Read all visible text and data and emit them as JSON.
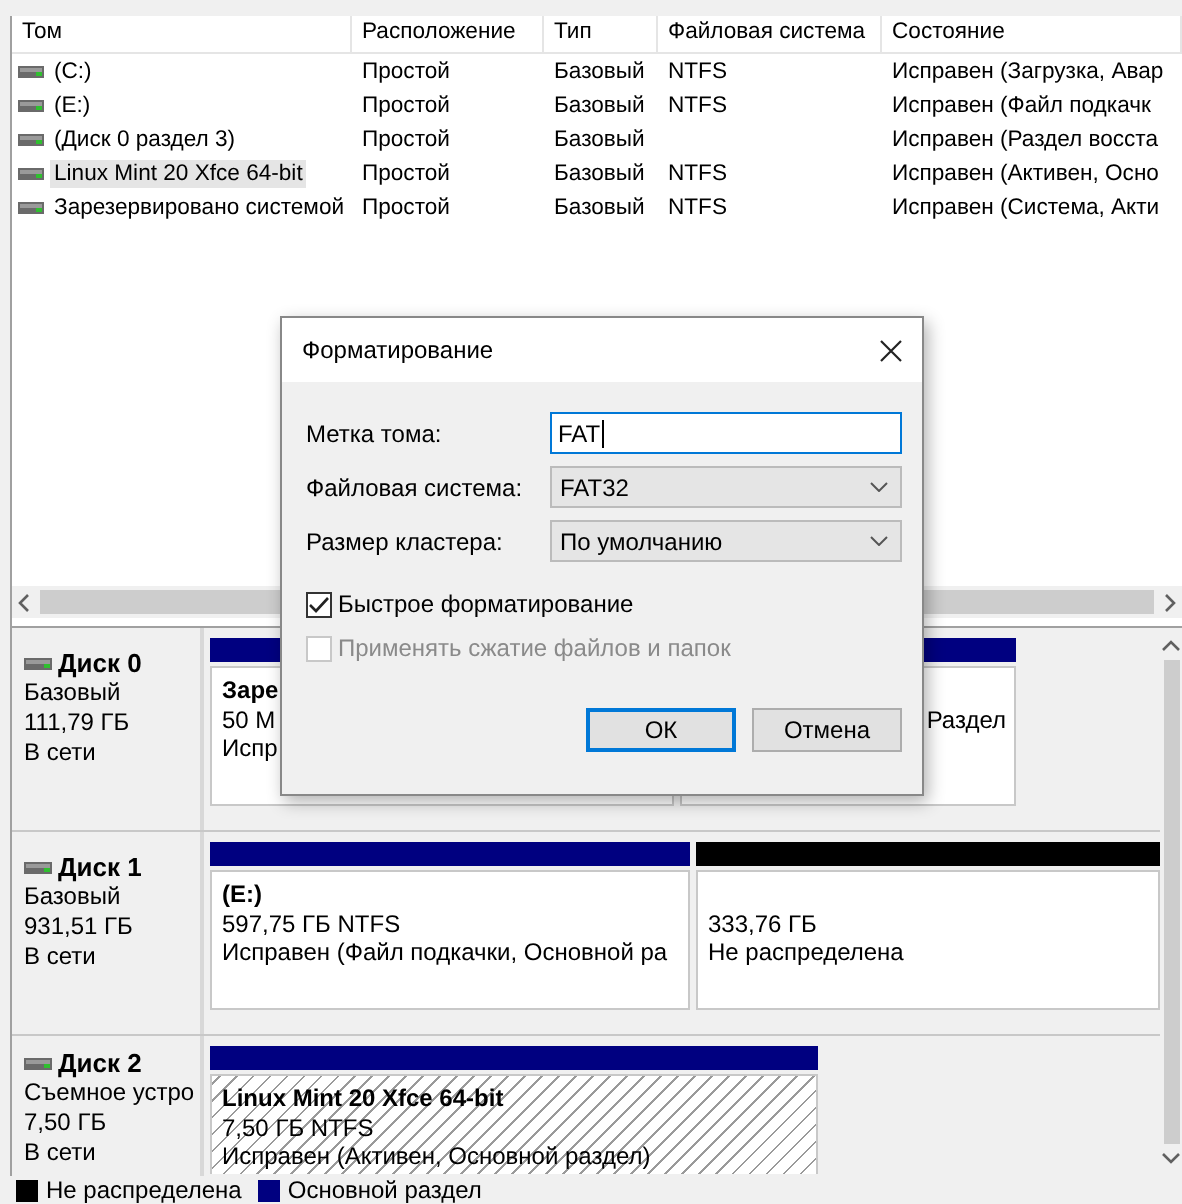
{
  "volume_table": {
    "columns": [
      "Том",
      "Расположение",
      "Тип",
      "Файловая система",
      "Состояние"
    ],
    "rows": [
      {
        "cells": [
          " (C:)",
          "Простой",
          "Базовый",
          "NTFS",
          "Исправен (Загрузка, Авар"
        ],
        "selected": false
      },
      {
        "cells": [
          " (E:)",
          "Простой",
          "Базовый",
          "NTFS",
          "Исправен (Файл подкачк"
        ],
        "selected": false
      },
      {
        "cells": [
          "(Диск 0 раздел 3)",
          "Простой",
          "Базовый",
          "",
          "Исправен (Раздел восста"
        ],
        "selected": false
      },
      {
        "cells": [
          "Linux Mint 20 Xfce 64-bit",
          "Простой",
          "Базовый",
          "NTFS",
          "Исправен (Активен, Осно"
        ],
        "selected": true
      },
      {
        "cells": [
          "Зарезервировано системой",
          "Простой",
          "Базовый",
          "NTFS",
          "Исправен (Система, Акти"
        ],
        "selected": false
      }
    ]
  },
  "disks": [
    {
      "name": "Диск 0",
      "lines": [
        "Базовый",
        "111,79 ГБ",
        "В сети"
      ],
      "partitions": [
        {
          "kind": "primary",
          "title": "Заре",
          "lines": [
            "50 М",
            "Испр"
          ]
        },
        {
          "kind": "primary",
          "lines": [
            "Раздел"
          ]
        }
      ]
    },
    {
      "name": "Диск 1",
      "lines": [
        "Базовый",
        "931,51 ГБ",
        "В сети"
      ],
      "partitions": [
        {
          "kind": "primary",
          "title": "(E:)",
          "lines": [
            "597,75 ГБ NTFS",
            "Исправен (Файл подкачки, Основной ра"
          ]
        },
        {
          "kind": "unallocated",
          "lines": [
            "333,76 ГБ",
            "Не распределена"
          ]
        }
      ]
    },
    {
      "name": "Диск 2",
      "lines": [
        "Съемное устро",
        "7,50 ГБ",
        "В сети"
      ],
      "partitions": [
        {
          "kind": "primary",
          "hatched": true,
          "title": "Linux Mint 20 Xfce 64-bit",
          "lines": [
            "7,50 ГБ NTFS",
            "Исправен (Активен, Основной раздел)"
          ]
        }
      ]
    }
  ],
  "legend": [
    {
      "label": "Не распределена",
      "color": "#000000"
    },
    {
      "label": "Основной раздел",
      "color": "#000080"
    }
  ],
  "dialog": {
    "title": "Форматирование",
    "fields": [
      {
        "kind": "text",
        "label": "Метка тома:",
        "value": "FAT"
      },
      {
        "kind": "select",
        "label": "Файловая система:",
        "value": "FAT32"
      },
      {
        "kind": "select",
        "label": "Размер кластера:",
        "value": "По умолчанию"
      }
    ],
    "options": [
      {
        "label": "Быстрое форматирование",
        "checked": true,
        "disabled": false
      },
      {
        "label": "Применять сжатие файлов и папок",
        "checked": false,
        "disabled": true
      }
    ],
    "buttons": [
      {
        "label": "ОК",
        "default": true
      },
      {
        "label": "Отмена",
        "default": false
      }
    ]
  }
}
